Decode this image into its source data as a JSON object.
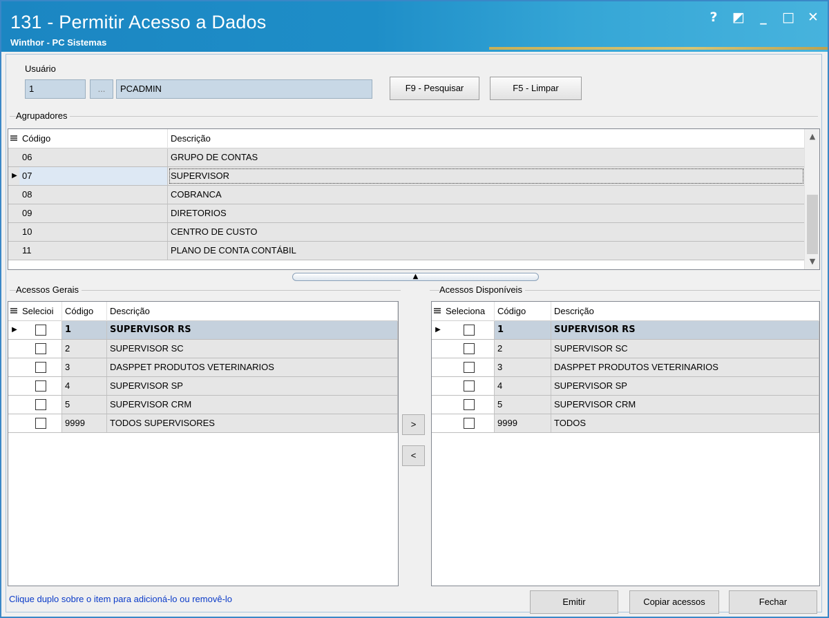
{
  "window": {
    "title": "131 - Permitir Acesso a Dados",
    "subtitle": "Winthor - PC Sistemas",
    "controls": [
      "?",
      "◩",
      "_",
      "□",
      "✕"
    ]
  },
  "user": {
    "label": "Usuário",
    "code": "1",
    "lookup_label": "...",
    "name": "PCADMIN",
    "search_button": "F9 - Pesquisar",
    "clear_button": "F5 - Limpar"
  },
  "groupers": {
    "title": "Agrupadores",
    "headers": [
      "Código",
      "Descrição"
    ],
    "rows": [
      {
        "code": "06",
        "desc": "GRUPO DE CONTAS",
        "selected": false
      },
      {
        "code": "07",
        "desc": "SUPERVISOR",
        "selected": true
      },
      {
        "code": "08",
        "desc": "COBRANCA",
        "selected": false
      },
      {
        "code": "09",
        "desc": "DIRETORIOS",
        "selected": false
      },
      {
        "code": "10",
        "desc": "CENTRO DE CUSTO",
        "selected": false
      },
      {
        "code": "11",
        "desc": "PLANO DE CONTA CONTÁBIL",
        "selected": false
      }
    ]
  },
  "general_access": {
    "title": "Acessos Gerais",
    "headers": [
      "Selecioi",
      "Código",
      "Descrição"
    ],
    "rows": [
      {
        "code": "1",
        "desc": "SUPERVISOR RS",
        "selected": true
      },
      {
        "code": "2",
        "desc": "SUPERVISOR SC",
        "selected": false
      },
      {
        "code": "3",
        "desc": "DASPPET PRODUTOS VETERINARIOS",
        "selected": false
      },
      {
        "code": "4",
        "desc": "SUPERVISOR SP",
        "selected": false
      },
      {
        "code": "5",
        "desc": "SUPERVISOR CRM",
        "selected": false
      },
      {
        "code": "9999",
        "desc": "TODOS SUPERVISORES",
        "selected": false
      }
    ]
  },
  "available_access": {
    "title": "Acessos Disponíveis",
    "headers": [
      "Seleciona",
      "Código",
      "Descrição"
    ],
    "rows": [
      {
        "code": "1",
        "desc": "SUPERVISOR RS",
        "selected": true
      },
      {
        "code": "2",
        "desc": "SUPERVISOR SC",
        "selected": false
      },
      {
        "code": "3",
        "desc": "DASPPET PRODUTOS VETERINARIOS",
        "selected": false
      },
      {
        "code": "4",
        "desc": "SUPERVISOR SP",
        "selected": false
      },
      {
        "code": "5",
        "desc": "SUPERVISOR CRM",
        "selected": false
      },
      {
        "code": "9999",
        "desc": "TODOS",
        "selected": false
      }
    ]
  },
  "transfer": {
    "add_label": ">",
    "remove_label": "<"
  },
  "footer": {
    "hint": "Clique duplo sobre o item para adicioná-lo ou removê-lo",
    "emit_button": "Emitir",
    "copy_button": "Copiar acessos",
    "close_button": "Fechar"
  },
  "colors": {
    "title_bar": "#1b86c2",
    "selected_row": "#c5d1dd",
    "row": "#e6e6e6",
    "hint_text": "#0a3ac8"
  }
}
